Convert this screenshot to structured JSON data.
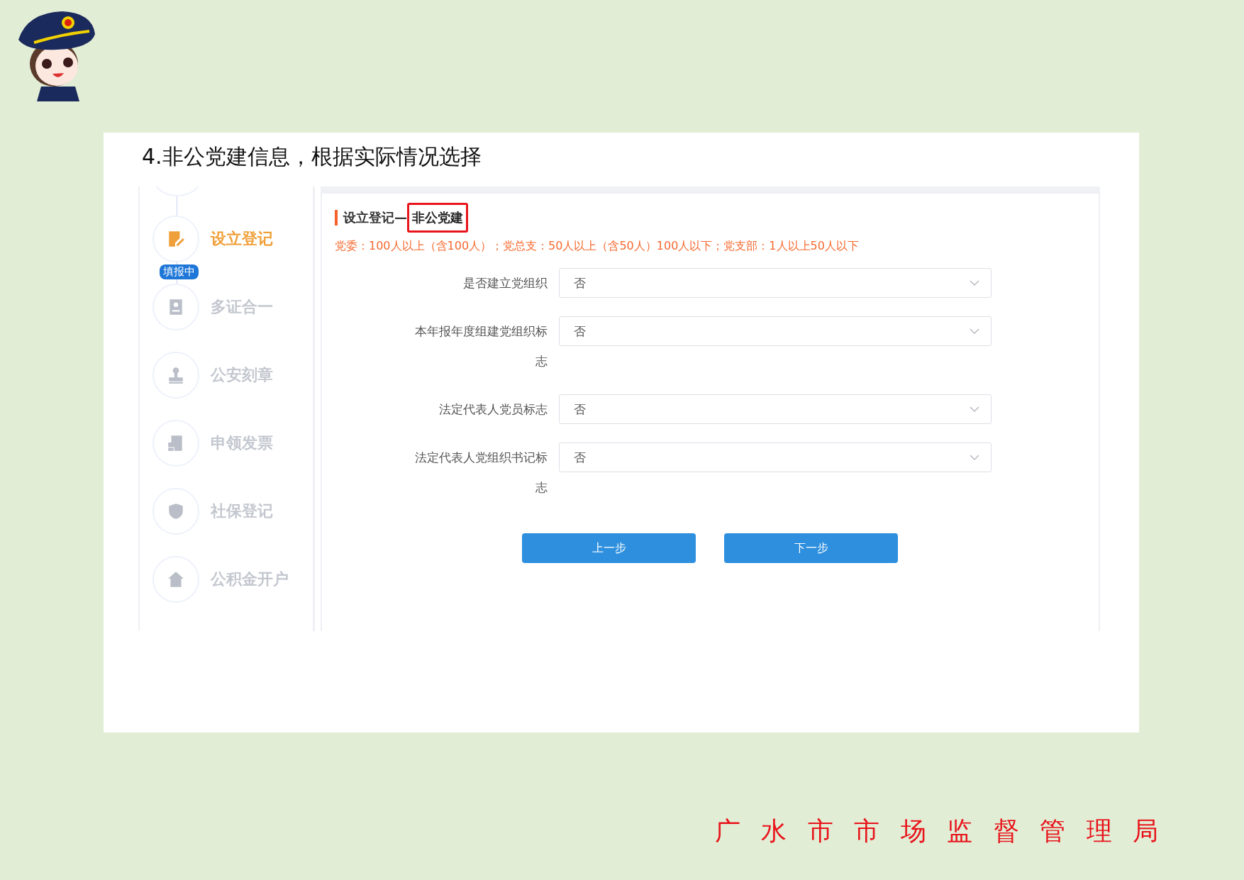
{
  "slide": {
    "title": "4.非公党建信息，根据实际情况选择"
  },
  "screenshot": {
    "steps": [
      {
        "label": "设立登记",
        "selected": true,
        "badge": "填报中"
      },
      {
        "label": "多证合一",
        "selected": false
      },
      {
        "label": "公安刻章",
        "selected": false
      },
      {
        "label": "申领发票",
        "selected": false
      },
      {
        "label": "社保登记",
        "selected": false
      },
      {
        "label": "公积金开户",
        "selected": false
      }
    ],
    "section": {
      "title": "设立登记—",
      "highlighted": "非公党建"
    },
    "hint": "党委：100人以上（含100人）；党总支：50人以上（含50人）100人以下；党支部：1人以上50人以下",
    "fields": [
      {
        "label": "是否建立党组织",
        "value": "否"
      },
      {
        "label": "本年报年度组建党组织标志",
        "value": "否"
      },
      {
        "label": "法定代表人党员标志",
        "value": "否"
      },
      {
        "label": "法定代表人党组织书记标志",
        "value": "否"
      }
    ],
    "buttons": [
      "上一步",
      "下一步"
    ]
  },
  "footer": "广 水 市 市 场 监 督 管 理 局"
}
